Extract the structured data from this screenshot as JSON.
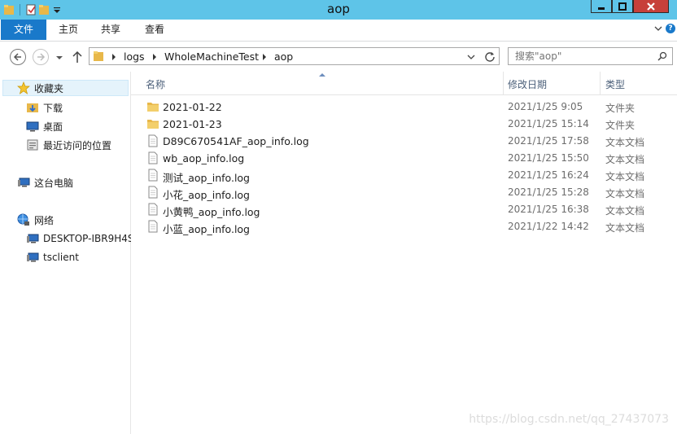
{
  "window": {
    "title": "aop"
  },
  "ribbon": {
    "tabs": [
      "文件",
      "主页",
      "共享",
      "查看"
    ]
  },
  "breadcrumb": [
    "logs",
    "WholeMachineTest",
    "aop"
  ],
  "search": {
    "placeholder": "搜索\"aop\""
  },
  "nav_pane": {
    "favorites": "收藏夹",
    "favorites_items": [
      "下载",
      "桌面",
      "最近访问的位置"
    ],
    "this_pc": "这台电脑",
    "network": "网络",
    "network_items": [
      "DESKTOP-IBR9H4S",
      "tsclient"
    ]
  },
  "columns": {
    "name": "名称",
    "date": "修改日期",
    "type": "类型"
  },
  "files": [
    {
      "name": "2021-01-22",
      "date": "2021/1/25 9:05",
      "type": "文件夹",
      "icon": "folder-icon"
    },
    {
      "name": "2021-01-23",
      "date": "2021/1/25 15:14",
      "type": "文件夹",
      "icon": "folder-icon"
    },
    {
      "name": "D89C670541AF_aop_info.log",
      "date": "2021/1/25 17:58",
      "type": "文本文档",
      "icon": "text-file-icon"
    },
    {
      "name": "wb_aop_info.log",
      "date": "2021/1/25 15:50",
      "type": "文本文档",
      "icon": "text-file-icon"
    },
    {
      "name": "测试_aop_info.log",
      "date": "2021/1/25 16:24",
      "type": "文本文档",
      "icon": "text-file-icon"
    },
    {
      "name": "小花_aop_info.log",
      "date": "2021/1/25 15:28",
      "type": "文本文档",
      "icon": "text-file-icon"
    },
    {
      "name": "小黄鸭_aop_info.log",
      "date": "2021/1/25 16:38",
      "type": "文本文档",
      "icon": "text-file-icon"
    },
    {
      "name": "小蓝_aop_info.log",
      "date": "2021/1/22 14:42",
      "type": "文本文档",
      "icon": "text-file-icon"
    }
  ],
  "watermark": "https://blog.csdn.net/qq_27437073",
  "colors": {
    "titlebar": "#5ec4e8",
    "accent": "#1979ca",
    "close": "#c7403a",
    "selection": "#e5f3fb"
  }
}
